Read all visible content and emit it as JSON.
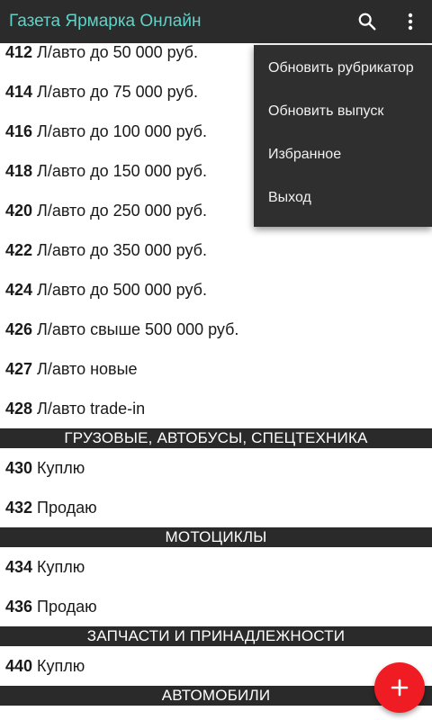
{
  "appbar": {
    "title": "Газета Ярмарка Онлайн",
    "search_icon": "search-icon",
    "overflow_icon": "more-vert-icon"
  },
  "list": {
    "rows_a": [
      {
        "code": "412",
        "label": "Л/авто до 50 000 руб."
      },
      {
        "code": "414",
        "label": "Л/авто до 75 000 руб."
      },
      {
        "code": "416",
        "label": "Л/авто до 100 000 руб."
      },
      {
        "code": "418",
        "label": "Л/авто до 150 000 руб."
      },
      {
        "code": "420",
        "label": "Л/авто до 250 000 руб."
      },
      {
        "code": "422",
        "label": "Л/авто до 350 000 руб."
      },
      {
        "code": "424",
        "label": "Л/авто до 500 000 руб."
      },
      {
        "code": "426",
        "label": "Л/авто свыше 500 000 руб."
      },
      {
        "code": "427",
        "label": "Л/авто новые"
      },
      {
        "code": "428",
        "label": "Л/авто trade-in"
      }
    ],
    "section_trucks": "ГРУЗОВЫЕ, АВТОБУСЫ, СПЕЦТЕХНИКА",
    "rows_b": [
      {
        "code": "430",
        "label": "Куплю"
      },
      {
        "code": "432",
        "label": "Продаю"
      }
    ],
    "section_moto": "МОТОЦИКЛЫ",
    "rows_c": [
      {
        "code": "434",
        "label": "Куплю"
      },
      {
        "code": "436",
        "label": "Продаю"
      }
    ],
    "section_parts": "ЗАПЧАСТИ И ПРИНАДЛЕЖНОСТИ",
    "rows_d": [
      {
        "code": "440",
        "label": "Куплю"
      }
    ],
    "section_cars": "АВТОМОБИЛИ"
  },
  "menu": {
    "items": [
      "Обновить рубрикатор",
      "Обновить выпуск",
      "Избранное",
      "Выход"
    ]
  },
  "fab": {
    "icon": "plus-icon",
    "color": "#f01c24"
  },
  "colors": {
    "appbar_bg": "#2b2b2b",
    "title": "#5fd3c7",
    "section_bg": "#2a2a2a",
    "menu_bg": "#2f2f2f"
  }
}
